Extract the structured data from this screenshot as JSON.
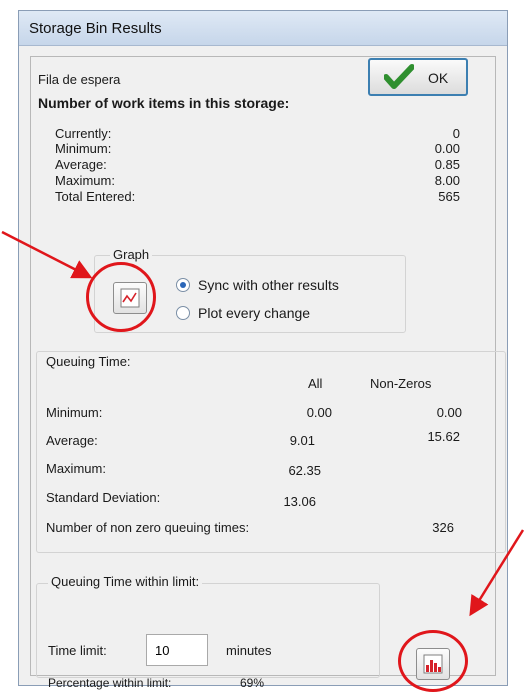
{
  "window": {
    "title": "Storage Bin Results"
  },
  "header": {
    "name": "Fila de espera",
    "heading": "Number of work items in this storage:"
  },
  "ok_button": {
    "label": "OK"
  },
  "stats": [
    {
      "label": "Currently:",
      "value": "0"
    },
    {
      "label": "Minimum:",
      "value": "0.00"
    },
    {
      "label": "Average:",
      "value": "0.85"
    },
    {
      "label": "Maximum:",
      "value": "8.00"
    },
    {
      "label": "Total Entered:",
      "value": "565"
    }
  ],
  "graph": {
    "legend": "Graph",
    "icon": "line-chart-icon",
    "options": [
      {
        "label": "Sync with other results",
        "selected": true
      },
      {
        "label": "Plot every change",
        "selected": false
      }
    ]
  },
  "queuing": {
    "legend": "Queuing Time:",
    "col_all": "All",
    "col_nonzero": "Non-Zeros",
    "rows": [
      {
        "label": "Minimum:",
        "all": "0.00",
        "nonzero": "0.00"
      },
      {
        "label": "Average:",
        "all": "9.01",
        "nonzero": "15.62"
      },
      {
        "label": "Maximum:",
        "all": "62.35",
        "nonzero": ""
      },
      {
        "label": "Standard Deviation:",
        "all": "13.06",
        "nonzero": ""
      }
    ],
    "nonzero_count_label": "Number of non zero queuing times:",
    "nonzero_count_value": "326"
  },
  "limit": {
    "legend": "Queuing Time within limit:",
    "time_limit_label": "Time limit:",
    "time_limit_value": "10",
    "unit": "minutes",
    "percentage_label": "Percentage within limit:",
    "percentage_value": "69%"
  },
  "histogram_button": {
    "icon": "histogram-icon"
  },
  "annotations": {
    "color": "#e0161b"
  }
}
